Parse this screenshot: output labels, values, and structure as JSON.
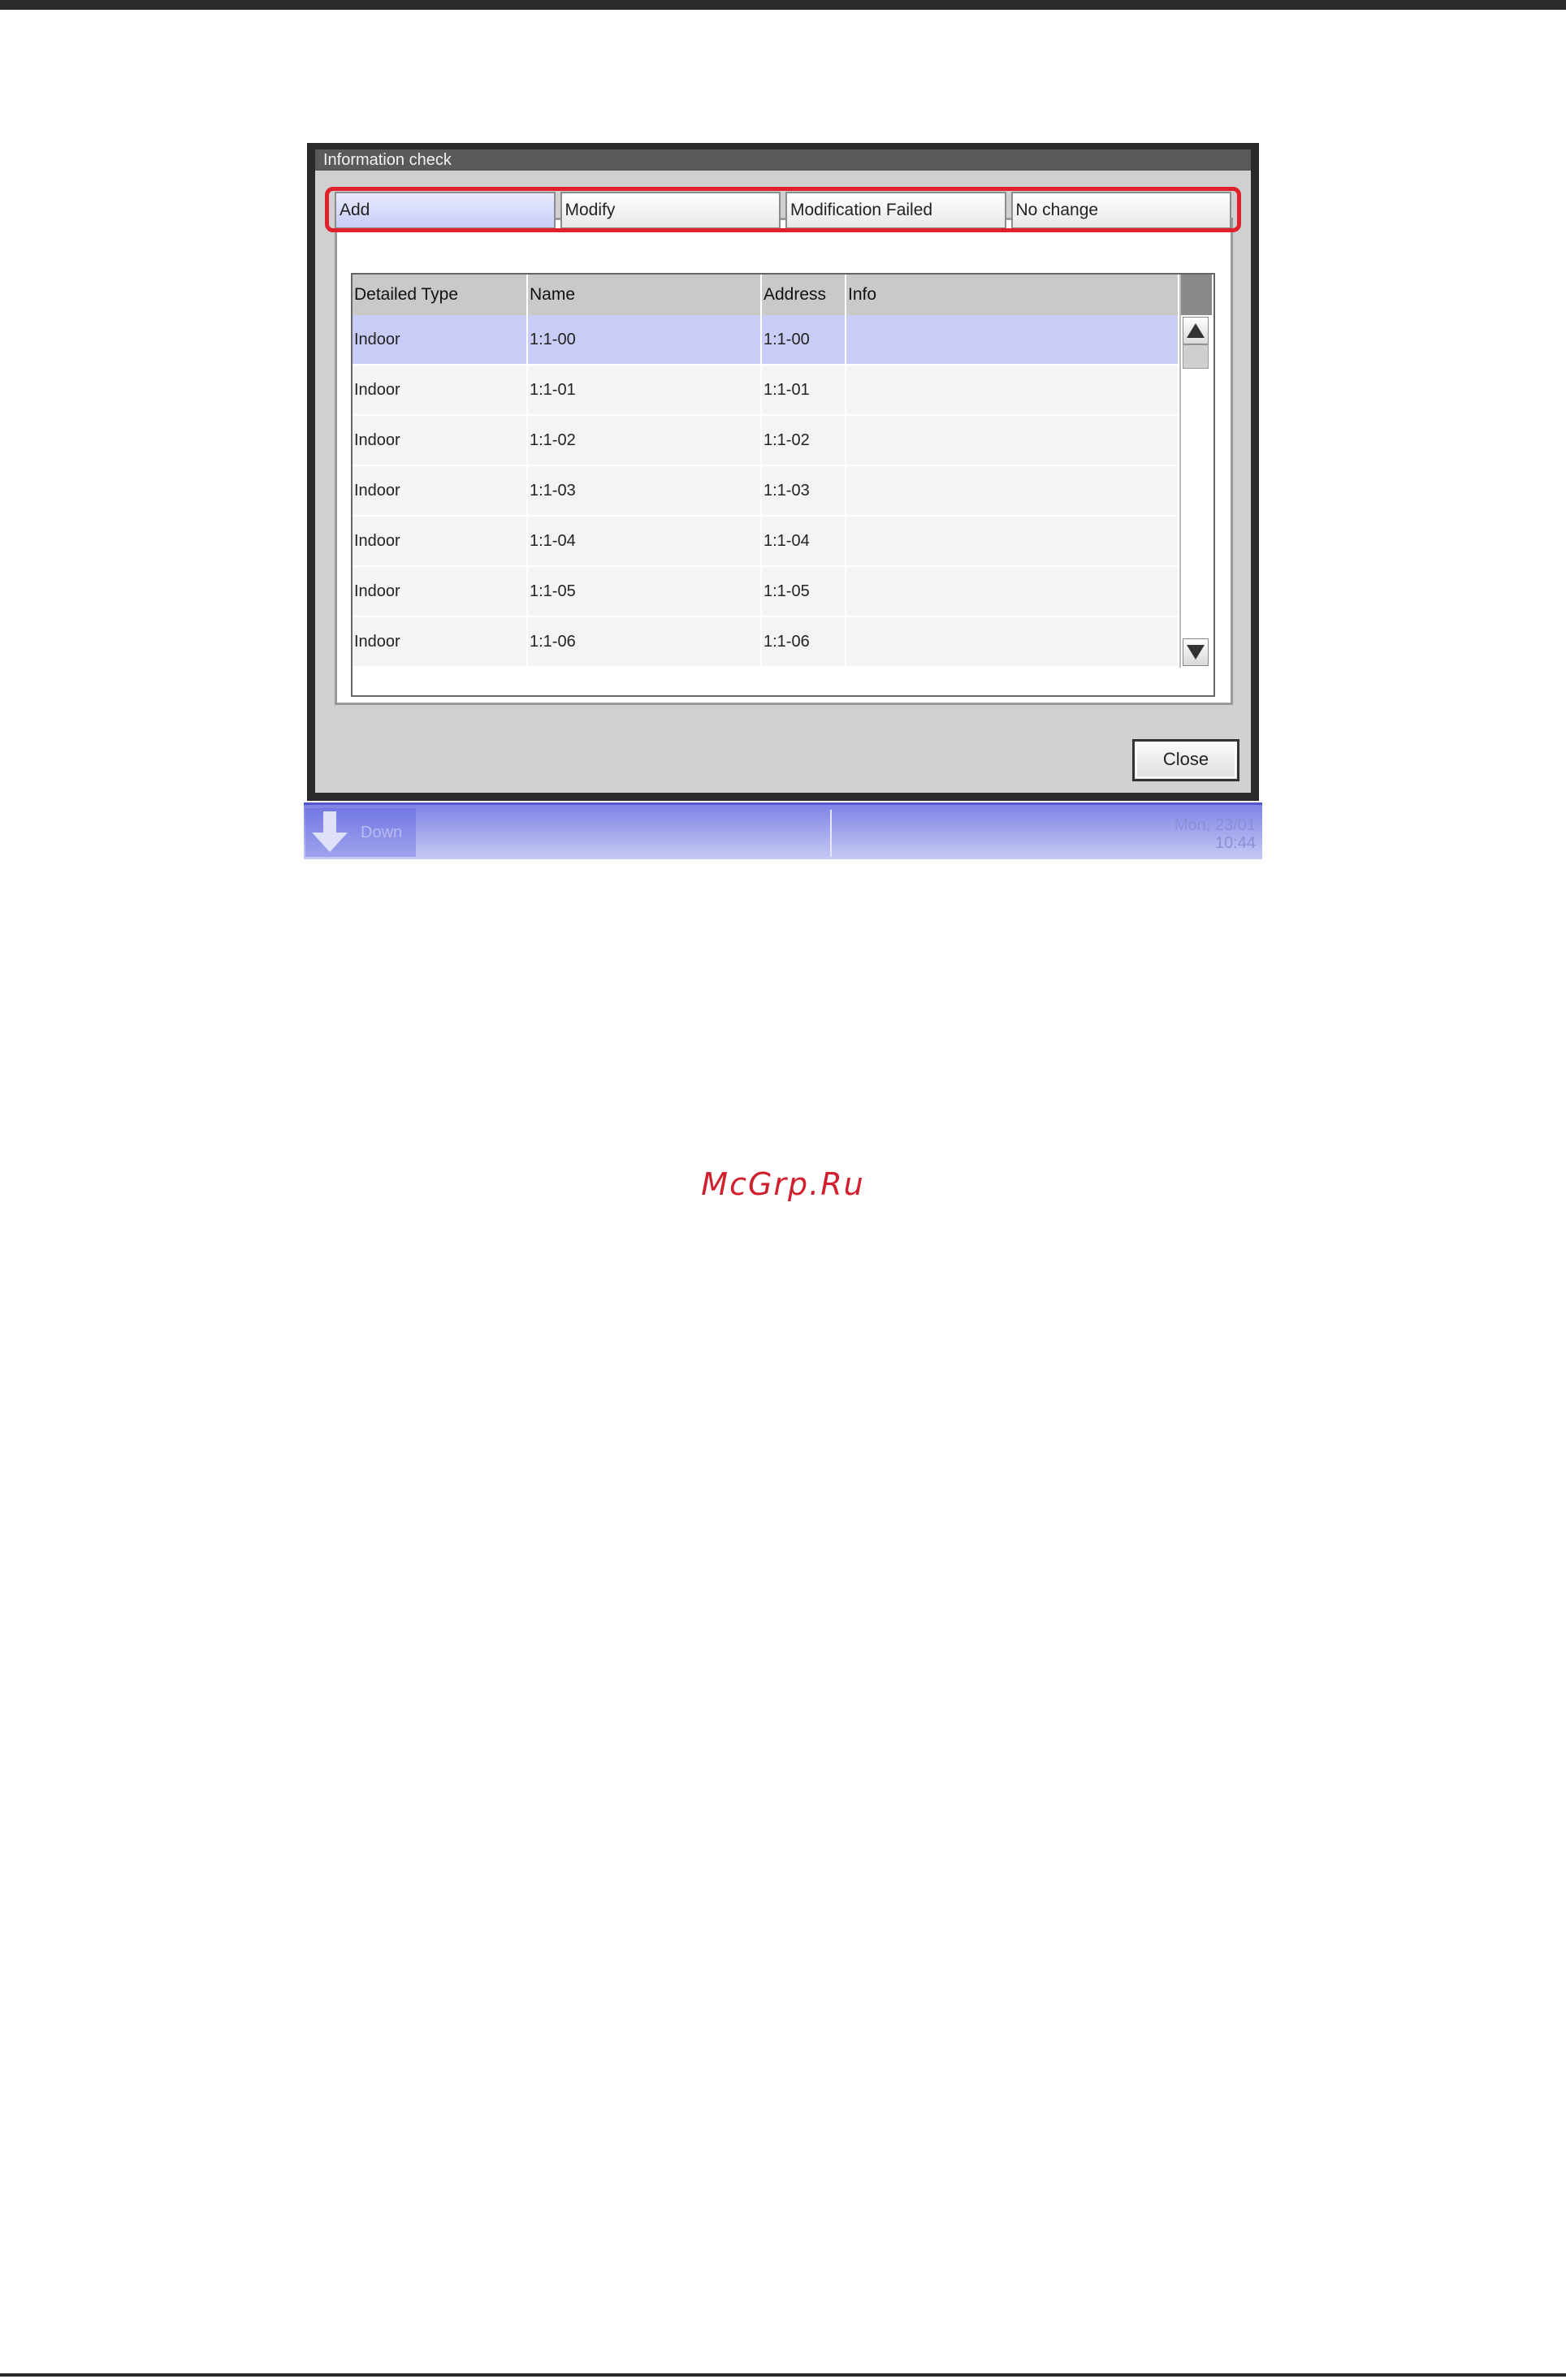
{
  "window": {
    "title": "Information check",
    "tabs": [
      {
        "label": "Add",
        "active": true
      },
      {
        "label": "Modify",
        "active": false
      },
      {
        "label": "Modification Failed",
        "active": false
      },
      {
        "label": "No change",
        "active": false
      }
    ],
    "table": {
      "headers": [
        "Detailed Type",
        "Name",
        "Address",
        "Info"
      ],
      "rows": [
        {
          "type": "Indoor",
          "name": "1:1-00",
          "address": "1:1-00",
          "info": "",
          "selected": true
        },
        {
          "type": "Indoor",
          "name": "1:1-01",
          "address": "1:1-01",
          "info": ""
        },
        {
          "type": "Indoor",
          "name": "1:1-02",
          "address": "1:1-02",
          "info": ""
        },
        {
          "type": "Indoor",
          "name": "1:1-03",
          "address": "1:1-03",
          "info": ""
        },
        {
          "type": "Indoor",
          "name": "1:1-04",
          "address": "1:1-04",
          "info": ""
        },
        {
          "type": "Indoor",
          "name": "1:1-05",
          "address": "1:1-05",
          "info": ""
        },
        {
          "type": "Indoor",
          "name": "1:1-06",
          "address": "1:1-06",
          "info": ""
        }
      ]
    },
    "close_label": "Close"
  },
  "status_bar": {
    "left_label": "Down",
    "date": "Mon, 23/01",
    "time": "10:44"
  },
  "watermark": "McGrp.Ru",
  "icons": {
    "scroll_up": "triangle-up-icon",
    "scroll_down": "triangle-down-icon",
    "status_arrow": "arrow-down-icon"
  },
  "colors": {
    "highlight_frame": "#e0202a",
    "selected_row": "#c9ccf4",
    "status_bar": "#7f84e6",
    "watermark": "#d01f2e"
  }
}
